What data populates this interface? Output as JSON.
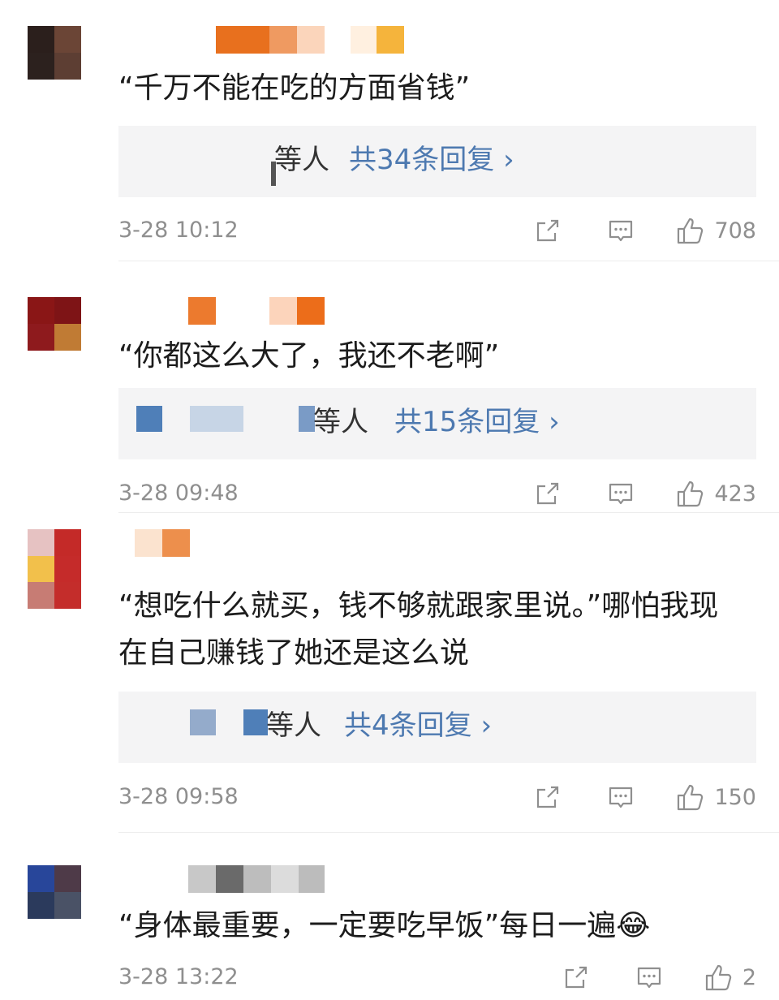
{
  "comments": [
    {
      "text": "“千万不能在吃的方面省钱”",
      "reply_suffix": "等人",
      "reply_count_label": "共34条回复 ›",
      "date": "3-28 10:12",
      "likes": "708",
      "avatar_colors": [
        "#2b1f1c",
        "#6b4536",
        "#2c211e",
        "#5d3e33"
      ],
      "name_colors": [
        "#e8701e",
        "#ef9a61",
        "#fbd5bb",
        "#ffffff",
        "#fff0e0",
        "#f5b43c"
      ]
    },
    {
      "text": "“你都这么大了，我还不老啊”",
      "reply_suffix": "等人",
      "reply_count_label": "共15条回复 ›",
      "date": "3-28 09:48",
      "likes": "423",
      "avatar_colors": [
        "#8a1616",
        "#7e1416",
        "#8e1a1d",
        "#c07b34"
      ],
      "name_colors": [
        "#ec7a2e",
        "#ffffff",
        "#fcd4bb",
        "#ec6d1a"
      ]
    },
    {
      "text": "“想吃什么就买，钱不够就跟家里说。”哪怕我现在自己赚钱了她还是这么说",
      "reply_suffix": "等人",
      "reply_count_label": "共4条回复 ›",
      "date": "3-28 09:58",
      "likes": "150",
      "avatar_colors": [
        "#e6c2c2",
        "#c42a28",
        "#f2c04b",
        "#c52b2a"
      ],
      "name_colors": [
        "#fbe3cf",
        "#ed8f4c"
      ]
    },
    {
      "text": "“身体最重要，一定要吃早饭”每日一遍😂",
      "date": "3-28 13:22",
      "likes": "2",
      "avatar_colors": [
        "#28469a",
        "#4e3a48",
        "#2b3a5c",
        "#4a5266"
      ],
      "name_colors": [
        "#c8c8c8",
        "#6a6a6a",
        "#bdbdbd",
        "#dcdcdc",
        "#bcbcbc"
      ]
    }
  ],
  "icons": [
    "share-icon",
    "comment-icon",
    "like-icon"
  ],
  "colors": {
    "reply_link": "#4d79b0",
    "meta_gray": "#8f8f8f",
    "reply_bg": "#f4f4f5"
  }
}
